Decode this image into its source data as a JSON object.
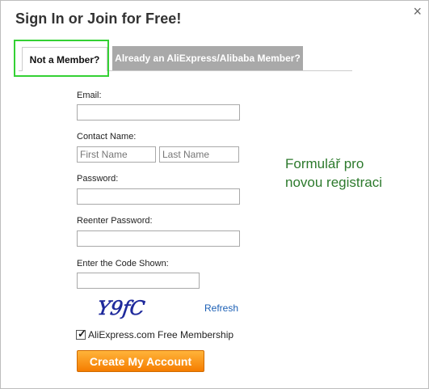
{
  "dialog": {
    "title": "Sign In or Join for Free!",
    "close_symbol": "×"
  },
  "tabs": [
    {
      "label": "Not a Member?",
      "active": true
    },
    {
      "label": "Already an AliExpress/Alibaba Member?",
      "active": false
    }
  ],
  "form": {
    "email_label": "Email:",
    "email_value": "",
    "contact_name_label": "Contact Name:",
    "first_name_placeholder": "First Name",
    "last_name_placeholder": "Last Name",
    "password_label": "Password:",
    "reenter_password_label": "Reenter Password:",
    "code_label": "Enter the Code Shown:",
    "code_value": "",
    "captcha_text": "Y9fC",
    "refresh_label": "Refresh",
    "membership_label": "AliExpress.com Free Membership",
    "membership_checked": true,
    "submit_label": "Create My Account"
  },
  "annotation": {
    "line1": "Formulář pro",
    "line2": "novou registraci"
  },
  "colors": {
    "highlight": "#34d134",
    "annotation_text": "#2d7a2d",
    "submit_button": "#f57d00",
    "link": "#1b5fb5"
  },
  "icons": {
    "close": "close-icon",
    "checkbox": "checkbox-checked-icon"
  }
}
